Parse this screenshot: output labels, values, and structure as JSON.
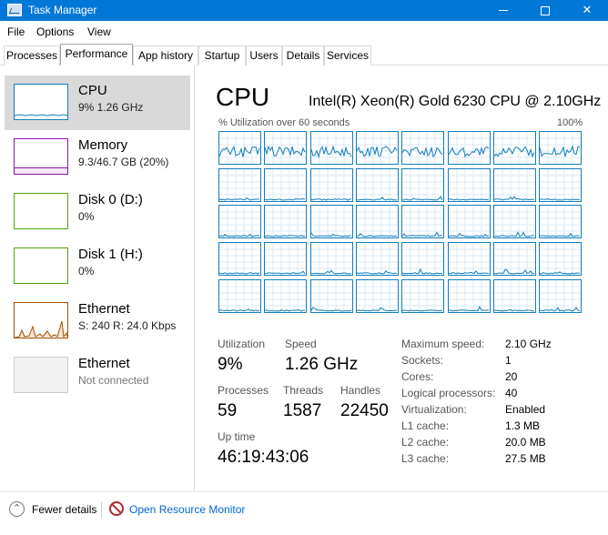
{
  "window": {
    "title": "Task Manager",
    "minimize": "—",
    "maximize": "☐",
    "close": "✕"
  },
  "menu": [
    "File",
    "Options",
    "View"
  ],
  "tabs": [
    "Processes",
    "Performance",
    "App history",
    "Startup",
    "Users",
    "Details",
    "Services"
  ],
  "active_tab": "Performance",
  "sidebar": {
    "items": [
      {
        "title": "CPU",
        "subtitle": "9% 1.26 GHz",
        "color": "#117dbb",
        "selected": true
      },
      {
        "title": "Memory",
        "subtitle": "9.3/46.7 GB (20%)",
        "color": "#8b12ae",
        "usage_fraction": 0.2
      },
      {
        "title": "Disk 0 (D:)",
        "subtitle": "0%",
        "color": "#4da60c"
      },
      {
        "title": "Disk 1 (H:)",
        "subtitle": "0%",
        "color": "#4da60c"
      },
      {
        "title": "Ethernet",
        "subtitle": "S: 240  R: 24.0 Kbps",
        "color": "#a74f01"
      },
      {
        "title": "Ethernet",
        "subtitle": "Not connected",
        "color": "#cccccc"
      }
    ]
  },
  "cpu": {
    "title": "CPU",
    "model": "Intel(R) Xeon(R) Gold 6230 CPU @ 2.10GHz",
    "graph_label": "% Utilization over 60 seconds",
    "graph_max": "100%",
    "graph_color": "#117dbb",
    "logical_processor_graphs": 40,
    "stats": {
      "utilization_label": "Utilization",
      "utilization": "9%",
      "speed_label": "Speed",
      "speed": "1.26 GHz",
      "processes_label": "Processes",
      "processes": "59",
      "threads_label": "Threads",
      "threads": "1587",
      "handles_label": "Handles",
      "handles": "22450",
      "uptime_label": "Up time",
      "uptime": "46:19:43:06"
    },
    "details": [
      {
        "label": "Maximum speed:",
        "value": "2.10 GHz"
      },
      {
        "label": "Sockets:",
        "value": "1"
      },
      {
        "label": "Cores:",
        "value": "20"
      },
      {
        "label": "Logical processors:",
        "value": "40"
      },
      {
        "label": "Virtualization:",
        "value": "Enabled"
      },
      {
        "label": "L1 cache:",
        "value": "1.3 MB"
      },
      {
        "label": "L2 cache:",
        "value": "20.0 MB"
      },
      {
        "label": "L3 cache:",
        "value": "27.5 MB"
      }
    ]
  },
  "footer": {
    "fewer_details": "Fewer details",
    "open_resource_monitor": "Open Resource Monitor"
  }
}
